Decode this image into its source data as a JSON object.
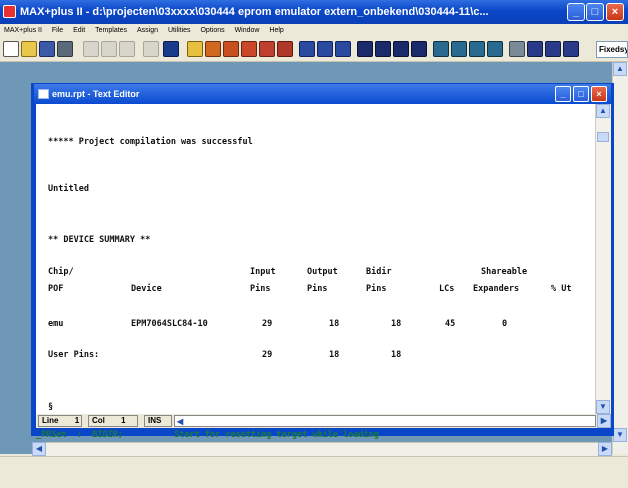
{
  "window": {
    "title": "MAX+plus II - d:\\projecten\\03xxxx\\030444 eprom emulator extern_onbekend\\030444-11\\c..."
  },
  "menubar": {
    "items": [
      "MAX+plus II",
      "File",
      "Edit",
      "Templates",
      "Assign",
      "Utilities",
      "Options",
      "Window",
      "Help"
    ]
  },
  "toolbar": {
    "find_label": "Fixedsys"
  },
  "editor_window": {
    "title": "emu.rpt - Text Editor"
  },
  "report": {
    "banner": "***** Project compilation was successful",
    "untitled": "Untitled",
    "section": "** DEVICE SUMMARY **",
    "header_row1": [
      "Chip/",
      "",
      "Input",
      "Output",
      "Bidir",
      "",
      "Shareable",
      ""
    ],
    "header_row2": [
      "POF",
      "Device",
      "Pins",
      "Pins",
      "Pins",
      "LCs",
      "Expanders",
      "% Ut"
    ],
    "rows": [
      [
        "emu",
        "EPM7064SLC84-10",
        "29",
        "18",
        "18",
        "45",
        "0",
        ""
      ]
    ],
    "user_pins": [
      "User Pins:",
      "29",
      "18",
      "18"
    ],
    "section_mark": "§"
  },
  "statusbar": {
    "line_label": "Line",
    "line_value": "1",
    "col_label": "Col",
    "col_value": "1",
    "mode": "INS"
  },
  "behind_text": "_PRSet  :  BIDIR;          Start for resetting target while loading"
}
